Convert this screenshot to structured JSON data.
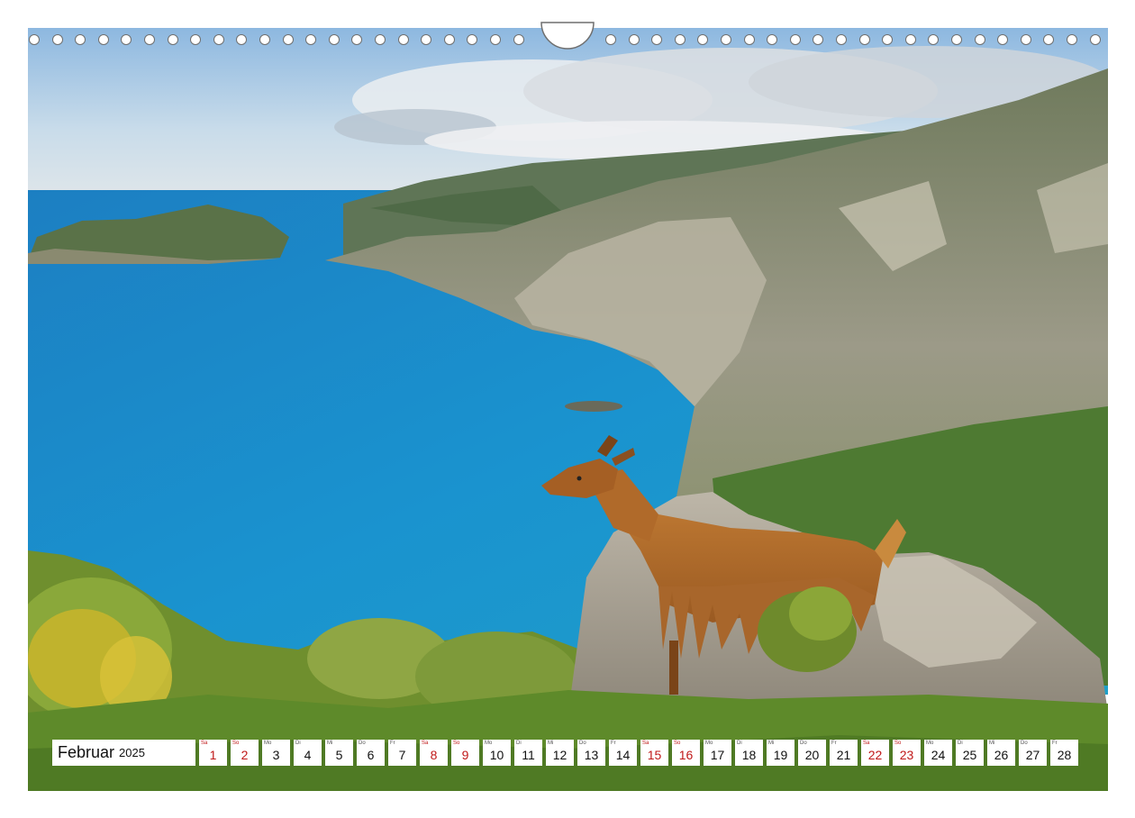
{
  "calendar": {
    "month": "Februar",
    "year": "2025",
    "days": [
      {
        "wd": "Sa",
        "num": "1",
        "red": true
      },
      {
        "wd": "So",
        "num": "2",
        "red": true
      },
      {
        "wd": "Mo",
        "num": "3",
        "red": false
      },
      {
        "wd": "Di",
        "num": "4",
        "red": false
      },
      {
        "wd": "Mi",
        "num": "5",
        "red": false
      },
      {
        "wd": "Do",
        "num": "6",
        "red": false
      },
      {
        "wd": "Fr",
        "num": "7",
        "red": false
      },
      {
        "wd": "Sa",
        "num": "8",
        "red": true
      },
      {
        "wd": "So",
        "num": "9",
        "red": true
      },
      {
        "wd": "Mo",
        "num": "10",
        "red": false
      },
      {
        "wd": "Di",
        "num": "11",
        "red": false
      },
      {
        "wd": "Mi",
        "num": "12",
        "red": false
      },
      {
        "wd": "Do",
        "num": "13",
        "red": false
      },
      {
        "wd": "Fr",
        "num": "14",
        "red": false
      },
      {
        "wd": "Sa",
        "num": "15",
        "red": true
      },
      {
        "wd": "So",
        "num": "16",
        "red": true
      },
      {
        "wd": "Mo",
        "num": "17",
        "red": false
      },
      {
        "wd": "Di",
        "num": "18",
        "red": false
      },
      {
        "wd": "Mi",
        "num": "19",
        "red": false
      },
      {
        "wd": "Do",
        "num": "20",
        "red": false
      },
      {
        "wd": "Fr",
        "num": "21",
        "red": false
      },
      {
        "wd": "Sa",
        "num": "22",
        "red": true
      },
      {
        "wd": "So",
        "num": "23",
        "red": true
      },
      {
        "wd": "Mo",
        "num": "24",
        "red": false
      },
      {
        "wd": "Di",
        "num": "25",
        "red": false
      },
      {
        "wd": "Mi",
        "num": "26",
        "red": false
      },
      {
        "wd": "Do",
        "num": "27",
        "red": false
      },
      {
        "wd": "Fr",
        "num": "28",
        "red": false
      }
    ]
  },
  "colors": {
    "weekend": "#c01818",
    "sea": "#1f8fc8",
    "cliff": "#8c8a78",
    "goat": "#b06a2a"
  },
  "photo": {
    "subject": "goat-on-rock-above-sea"
  }
}
